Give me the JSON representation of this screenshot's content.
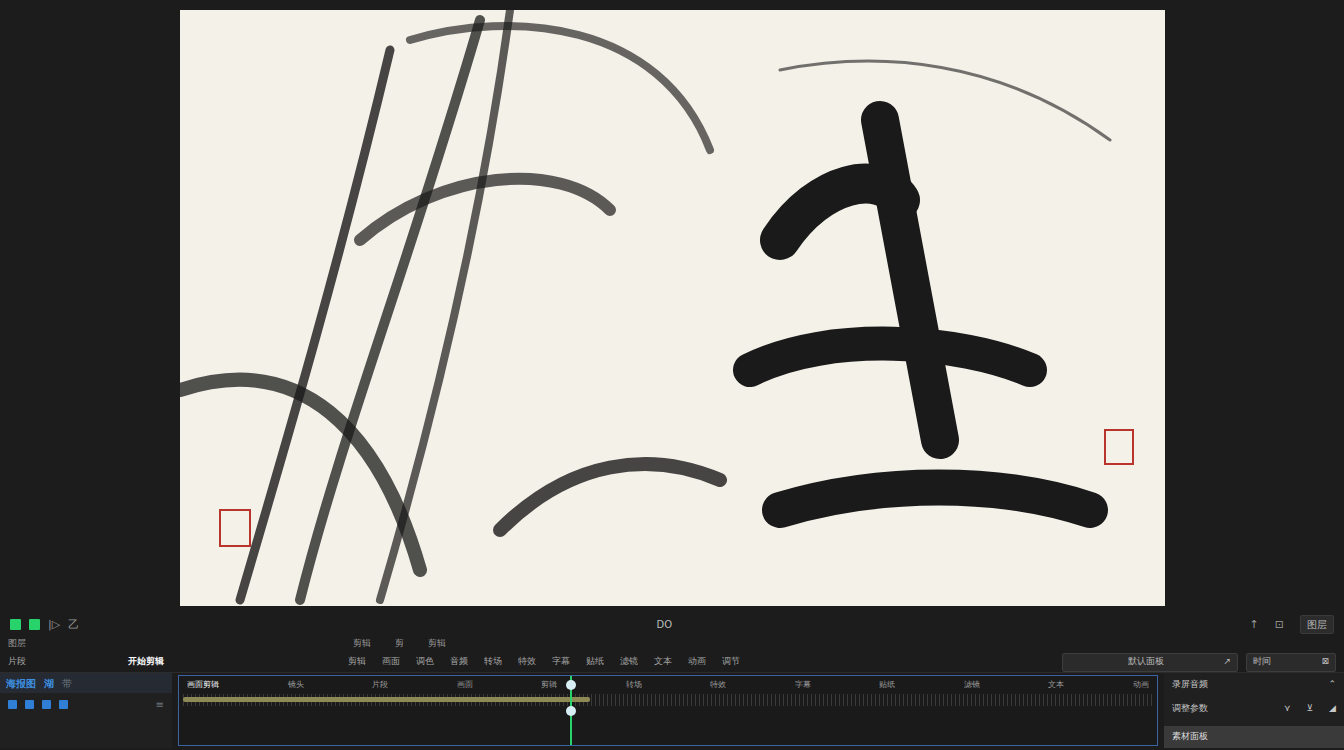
{
  "transport": {
    "controls": [
      {
        "label": "",
        "on": true
      },
      {
        "label": "",
        "on": true
      },
      {
        "label": "|▷",
        "on": false
      },
      {
        "label": "乙",
        "on": false
      }
    ],
    "timecode": "DO",
    "right": [
      "↑",
      "⊡",
      "图层"
    ]
  },
  "edit_row": {
    "left": "图层",
    "items": [
      "剪辑",
      "剪",
      "剪辑"
    ]
  },
  "tool_row": {
    "title": "片段",
    "name": "开始剪辑",
    "tools": [
      "剪辑",
      "画面",
      "调色",
      "音频",
      "转场",
      "特效",
      "字幕",
      "贴纸",
      "滤镜",
      "文本",
      "动画",
      "调节"
    ]
  },
  "panel_select": {
    "value": "默认面板",
    "arrow": "↗"
  },
  "time_field": {
    "value": "时间",
    "arrow": "⊠"
  },
  "layers": {
    "title": "海报图",
    "tags": [
      "湖",
      "带"
    ],
    "menu": "≡"
  },
  "timeline": {
    "track_label": "画面剪辑",
    "ruler": [
      "镜头",
      "片段",
      "画面",
      "剪辑",
      "转场",
      "特效",
      "字幕",
      "贴纸",
      "滤镜",
      "文本",
      "动画"
    ],
    "playhead": 0.4,
    "clip_level": 0.42
  },
  "inspector": {
    "title": "录屏音频",
    "chevron": "⌃",
    "row": "调整参数",
    "row_icons": [
      "⋎",
      "⊻",
      "◢"
    ],
    "footer": "素材面板"
  }
}
